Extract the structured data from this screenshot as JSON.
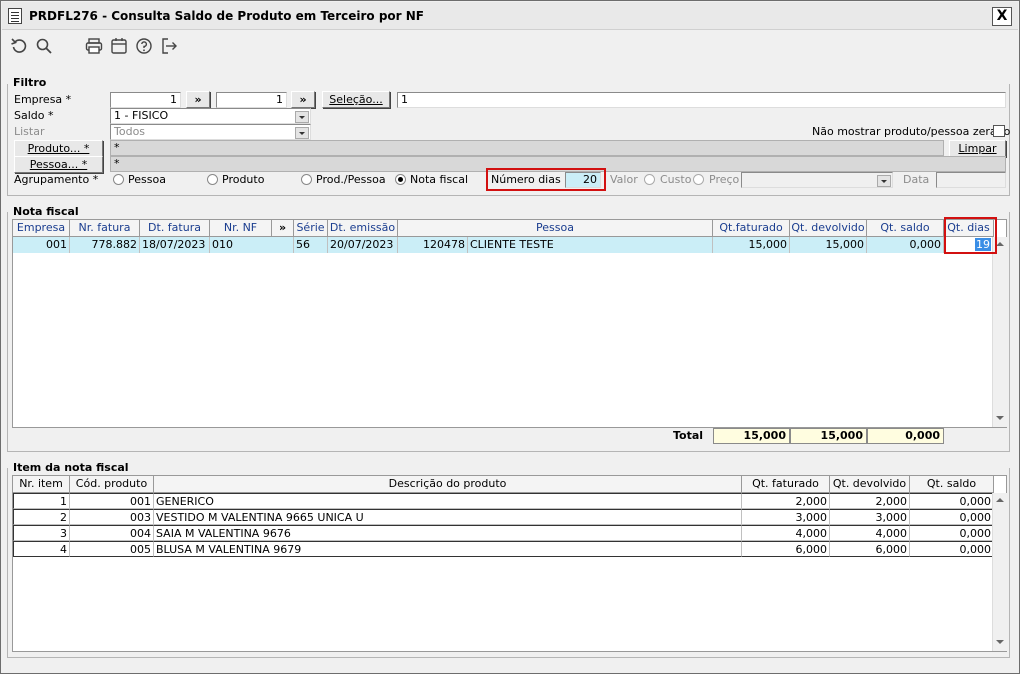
{
  "window": {
    "title": "PRDFL276 - Consulta Saldo de Produto em Terceiro por NF",
    "close_label": "X"
  },
  "toolbar": {
    "icons": [
      "undo-icon",
      "search-icon",
      "print-icon",
      "calendar-icon",
      "help-icon",
      "exit-icon"
    ]
  },
  "filtro": {
    "title": "Filtro",
    "empresa_label": "Empresa *",
    "empresa_from": "1",
    "empresa_to": "1",
    "range_button": "»",
    "selecao_button": "Seleção...",
    "selecao_value": "1",
    "saldo_label": "Saldo *",
    "saldo_value": "1 - FISICO",
    "listar_label": "Listar",
    "listar_value": "Todos",
    "nao_mostrar_label": "Não mostrar produto/pessoa zerado",
    "produto_button": "Produto... *",
    "produto_value": "*",
    "pessoa_button": "Pessoa... *",
    "pessoa_value": "*",
    "limpar_button": "Limpar",
    "agrupamento_label": "Agrupamento *",
    "agrupamento_options": [
      "Pessoa",
      "Produto",
      "Prod./Pessoa",
      "Nota fiscal"
    ],
    "agrupamento_selected": "Nota fiscal",
    "numero_dias_label": "Número dias",
    "numero_dias_value": "20",
    "valor_label": "Valor",
    "custo_label": "Custo",
    "preco_label": "Preço",
    "data_label": "Data"
  },
  "nota_fiscal": {
    "title": "Nota fiscal",
    "columns": [
      "Empresa",
      "Nr. fatura",
      "Dt. fatura",
      "Nr. NF",
      "»",
      "Série",
      "Dt. emissão",
      "Pessoa",
      "Qt.faturado",
      "Qt. devolvido",
      "Qt. saldo",
      "Qt. dias"
    ],
    "rows": [
      {
        "empresa": "001",
        "nr_fatura": "778.882",
        "dt_fatura": "18/07/2023",
        "nr_nf": "010",
        "serie": "56",
        "dt_emissao": "20/07/2023",
        "pessoa_cod": "120478",
        "pessoa_nome": "CLIENTE TESTE",
        "qt_faturado": "15,000",
        "qt_devolvido": "15,000",
        "qt_saldo": "0,000",
        "qt_dias": "19"
      }
    ],
    "total_label": "Total",
    "total_faturado": "15,000",
    "total_devolvido": "15,000",
    "total_saldo": "0,000"
  },
  "item_nf": {
    "title": "Item da nota fiscal",
    "columns": [
      "Nr. item",
      "Cód. produto",
      "Descrição do produto",
      "Qt. faturado",
      "Qt. devolvido",
      "Qt. saldo"
    ],
    "rows": [
      {
        "nr": "1",
        "cod": "001",
        "desc": "GENERICO",
        "fat": "2,000",
        "dev": "2,000",
        "saldo": "0,000"
      },
      {
        "nr": "2",
        "cod": "003",
        "desc": "VESTIDO M VALENTINA 9665 UNICA U",
        "fat": "3,000",
        "dev": "3,000",
        "saldo": "0,000"
      },
      {
        "nr": "3",
        "cod": "004",
        "desc": "SAIA M VALENTINA 9676",
        "fat": "4,000",
        "dev": "4,000",
        "saldo": "0,000"
      },
      {
        "nr": "4",
        "cod": "005",
        "desc": "BLUSA M VALENTINA 9679",
        "fat": "6,000",
        "dev": "6,000",
        "saldo": "0,000"
      }
    ]
  }
}
